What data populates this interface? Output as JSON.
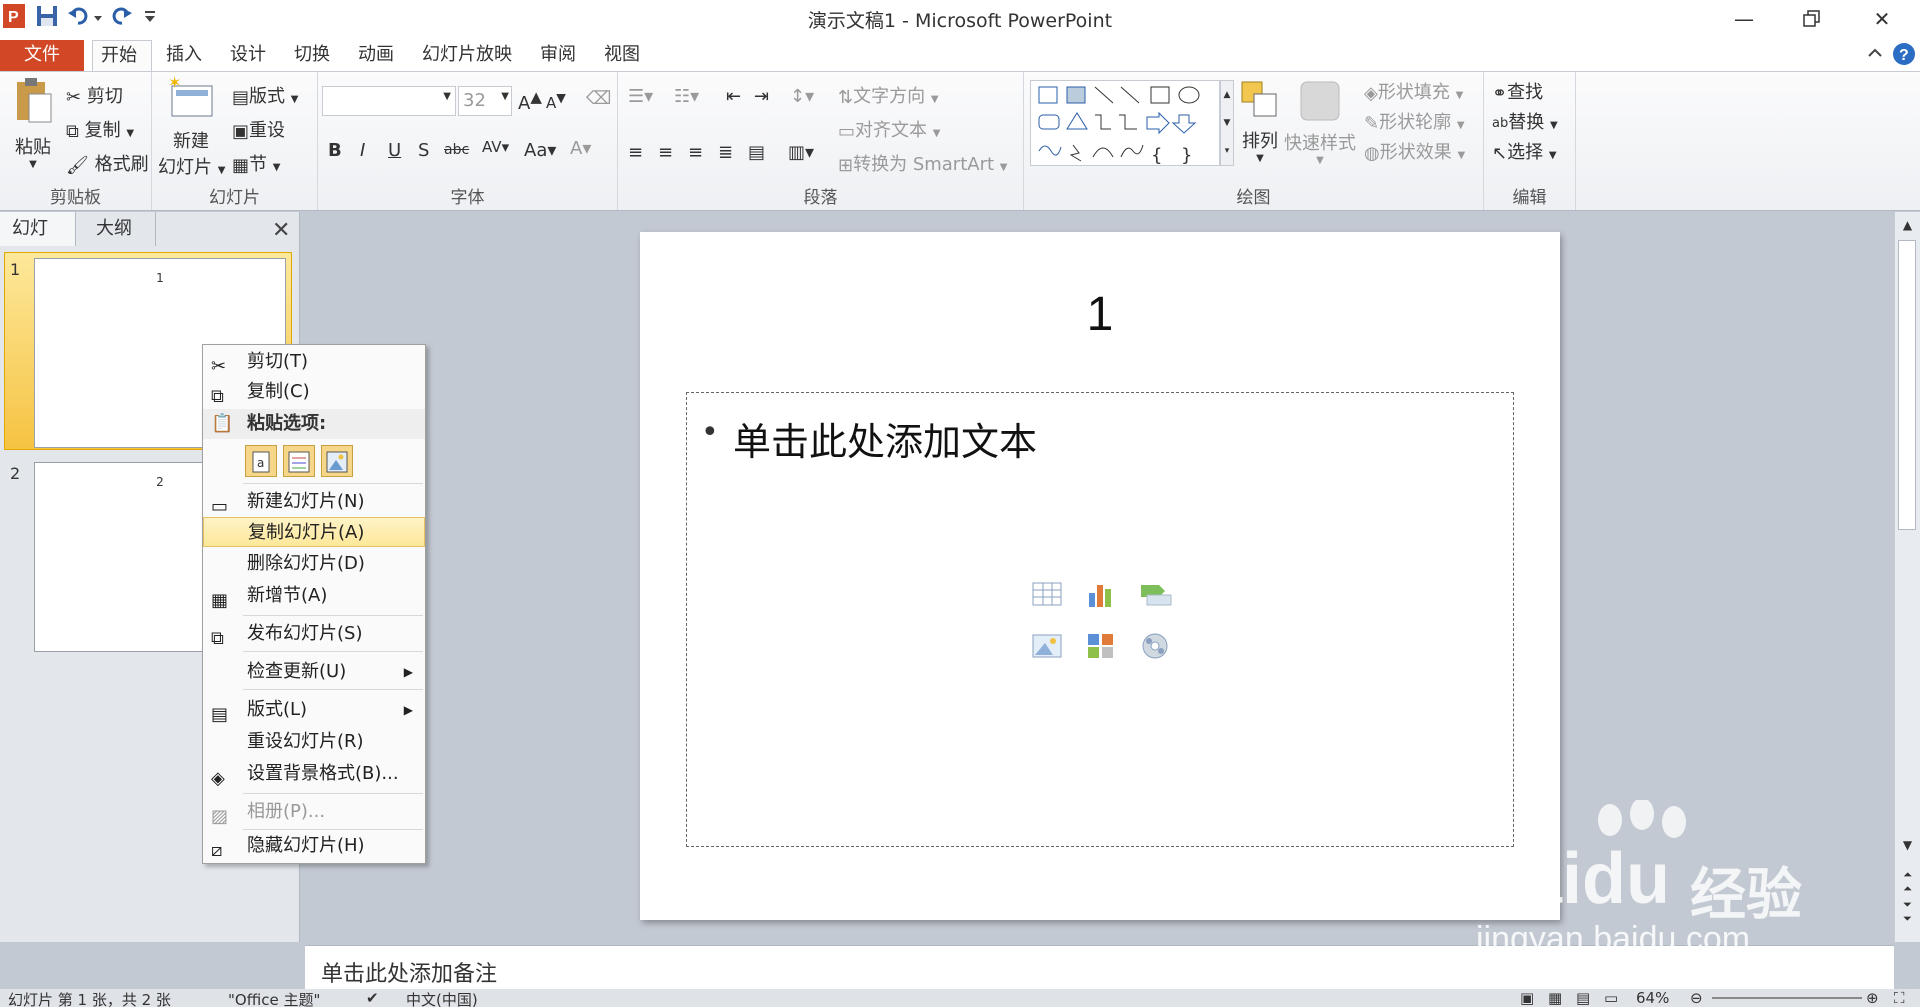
{
  "titlebar": {
    "title": "演示文稿1 - Microsoft PowerPoint"
  },
  "tabs": [
    {
      "label": "文件"
    },
    {
      "label": "开始"
    },
    {
      "label": "插入"
    },
    {
      "label": "设计"
    },
    {
      "label": "切换"
    },
    {
      "label": "动画"
    },
    {
      "label": "幻灯片放映"
    },
    {
      "label": "审阅"
    },
    {
      "label": "视图"
    }
  ],
  "ribbon": {
    "clipboard": {
      "label": "剪贴板",
      "paste": "粘贴",
      "cut": "剪切",
      "copy": "复制",
      "format_painter": "格式刷"
    },
    "slides": {
      "label": "幻灯片",
      "new_slide_1": "新建",
      "new_slide_2": "幻灯片",
      "layout": "版式",
      "reset": "重设",
      "section": "节"
    },
    "font": {
      "label": "字体",
      "size": "32"
    },
    "paragraph": {
      "label": "段落",
      "text_direction": "文字方向",
      "align_text": "对齐文本",
      "smartart": "转换为 SmartArt"
    },
    "drawing": {
      "label": "绘图",
      "arrange": "排列",
      "quick_styles": "快速样式",
      "shape_fill": "形状填充",
      "shape_outline": "形状轮廓",
      "shape_effects": "形状效果"
    },
    "editing": {
      "label": "编辑",
      "find": "查找",
      "replace": "替换",
      "select": "选择"
    }
  },
  "leftpane": {
    "tab_slides": "幻灯片",
    "tab_outline": "大纲",
    "slides": [
      {
        "num": "1",
        "title": "1"
      },
      {
        "num": "2",
        "title": "2"
      }
    ]
  },
  "slide": {
    "title": "1",
    "content": "单击此处添加文本"
  },
  "notes": {
    "placeholder": "单击此处添加备注"
  },
  "statusbar": {
    "slide_info": "幻灯片 第 1 张，共 2 张",
    "theme": "\"Office 主题\"",
    "language": "中文(中国)",
    "zoom": "64%"
  },
  "context_menu": {
    "cut": "剪切(T)",
    "copy": "复制(C)",
    "paste_options": "粘贴选项:",
    "new_slide": "新建幻灯片(N)",
    "duplicate_slide": "复制幻灯片(A)",
    "delete_slide": "删除幻灯片(D)",
    "add_section": "新增节(A)",
    "publish_slides": "发布幻灯片(S)",
    "check_updates": "检查更新(U)",
    "layout": "版式(L)",
    "reset_slide": "重设幻灯片(R)",
    "format_background": "设置背景格式(B)...",
    "photo_album": "相册(P)...",
    "hide_slide": "隐藏幻灯片(H)"
  },
  "watermark": {
    "brand": "Bai",
    "paw": "du",
    "jingyan": "经验",
    "url": "jingyan.baidu.com"
  },
  "colors": {
    "file_tab": "#d24726",
    "highlight": "#fde89a",
    "selected_thumb": "#f6c343"
  }
}
